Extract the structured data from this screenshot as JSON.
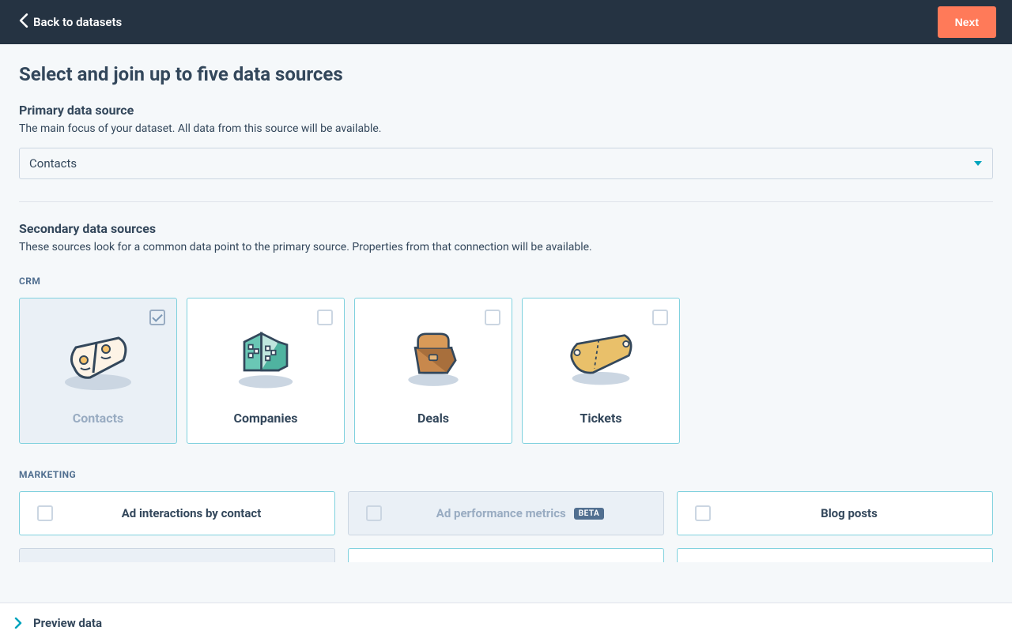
{
  "header": {
    "back_label": "Back to datasets",
    "next_label": "Next"
  },
  "page": {
    "title": "Select and join up to five data sources"
  },
  "primary": {
    "title": "Primary data source",
    "description": "The main focus of your dataset. All data from this source will be available.",
    "selected_value": "Contacts"
  },
  "secondary": {
    "title": "Secondary data sources",
    "description": "These sources look for a common data point to the primary source. Properties from that connection will be available."
  },
  "categories": {
    "crm": {
      "label": "CRM",
      "cards": [
        {
          "label": "Contacts",
          "selected": true
        },
        {
          "label": "Companies",
          "selected": false
        },
        {
          "label": "Deals",
          "selected": false
        },
        {
          "label": "Tickets",
          "selected": false
        }
      ]
    },
    "marketing": {
      "label": "MARKETING",
      "items": [
        {
          "label": "Ad interactions by contact",
          "disabled": false
        },
        {
          "label": "Ad performance metrics",
          "disabled": true,
          "badge": "BETA"
        },
        {
          "label": "Blog posts",
          "disabled": false
        }
      ]
    }
  },
  "footer": {
    "preview_label": "Preview data"
  },
  "colors": {
    "accent": "#ff7a59",
    "teal": "#00a4bd",
    "teal_border": "#7fd1de",
    "text": "#33475b",
    "muted": "#99acc2"
  }
}
